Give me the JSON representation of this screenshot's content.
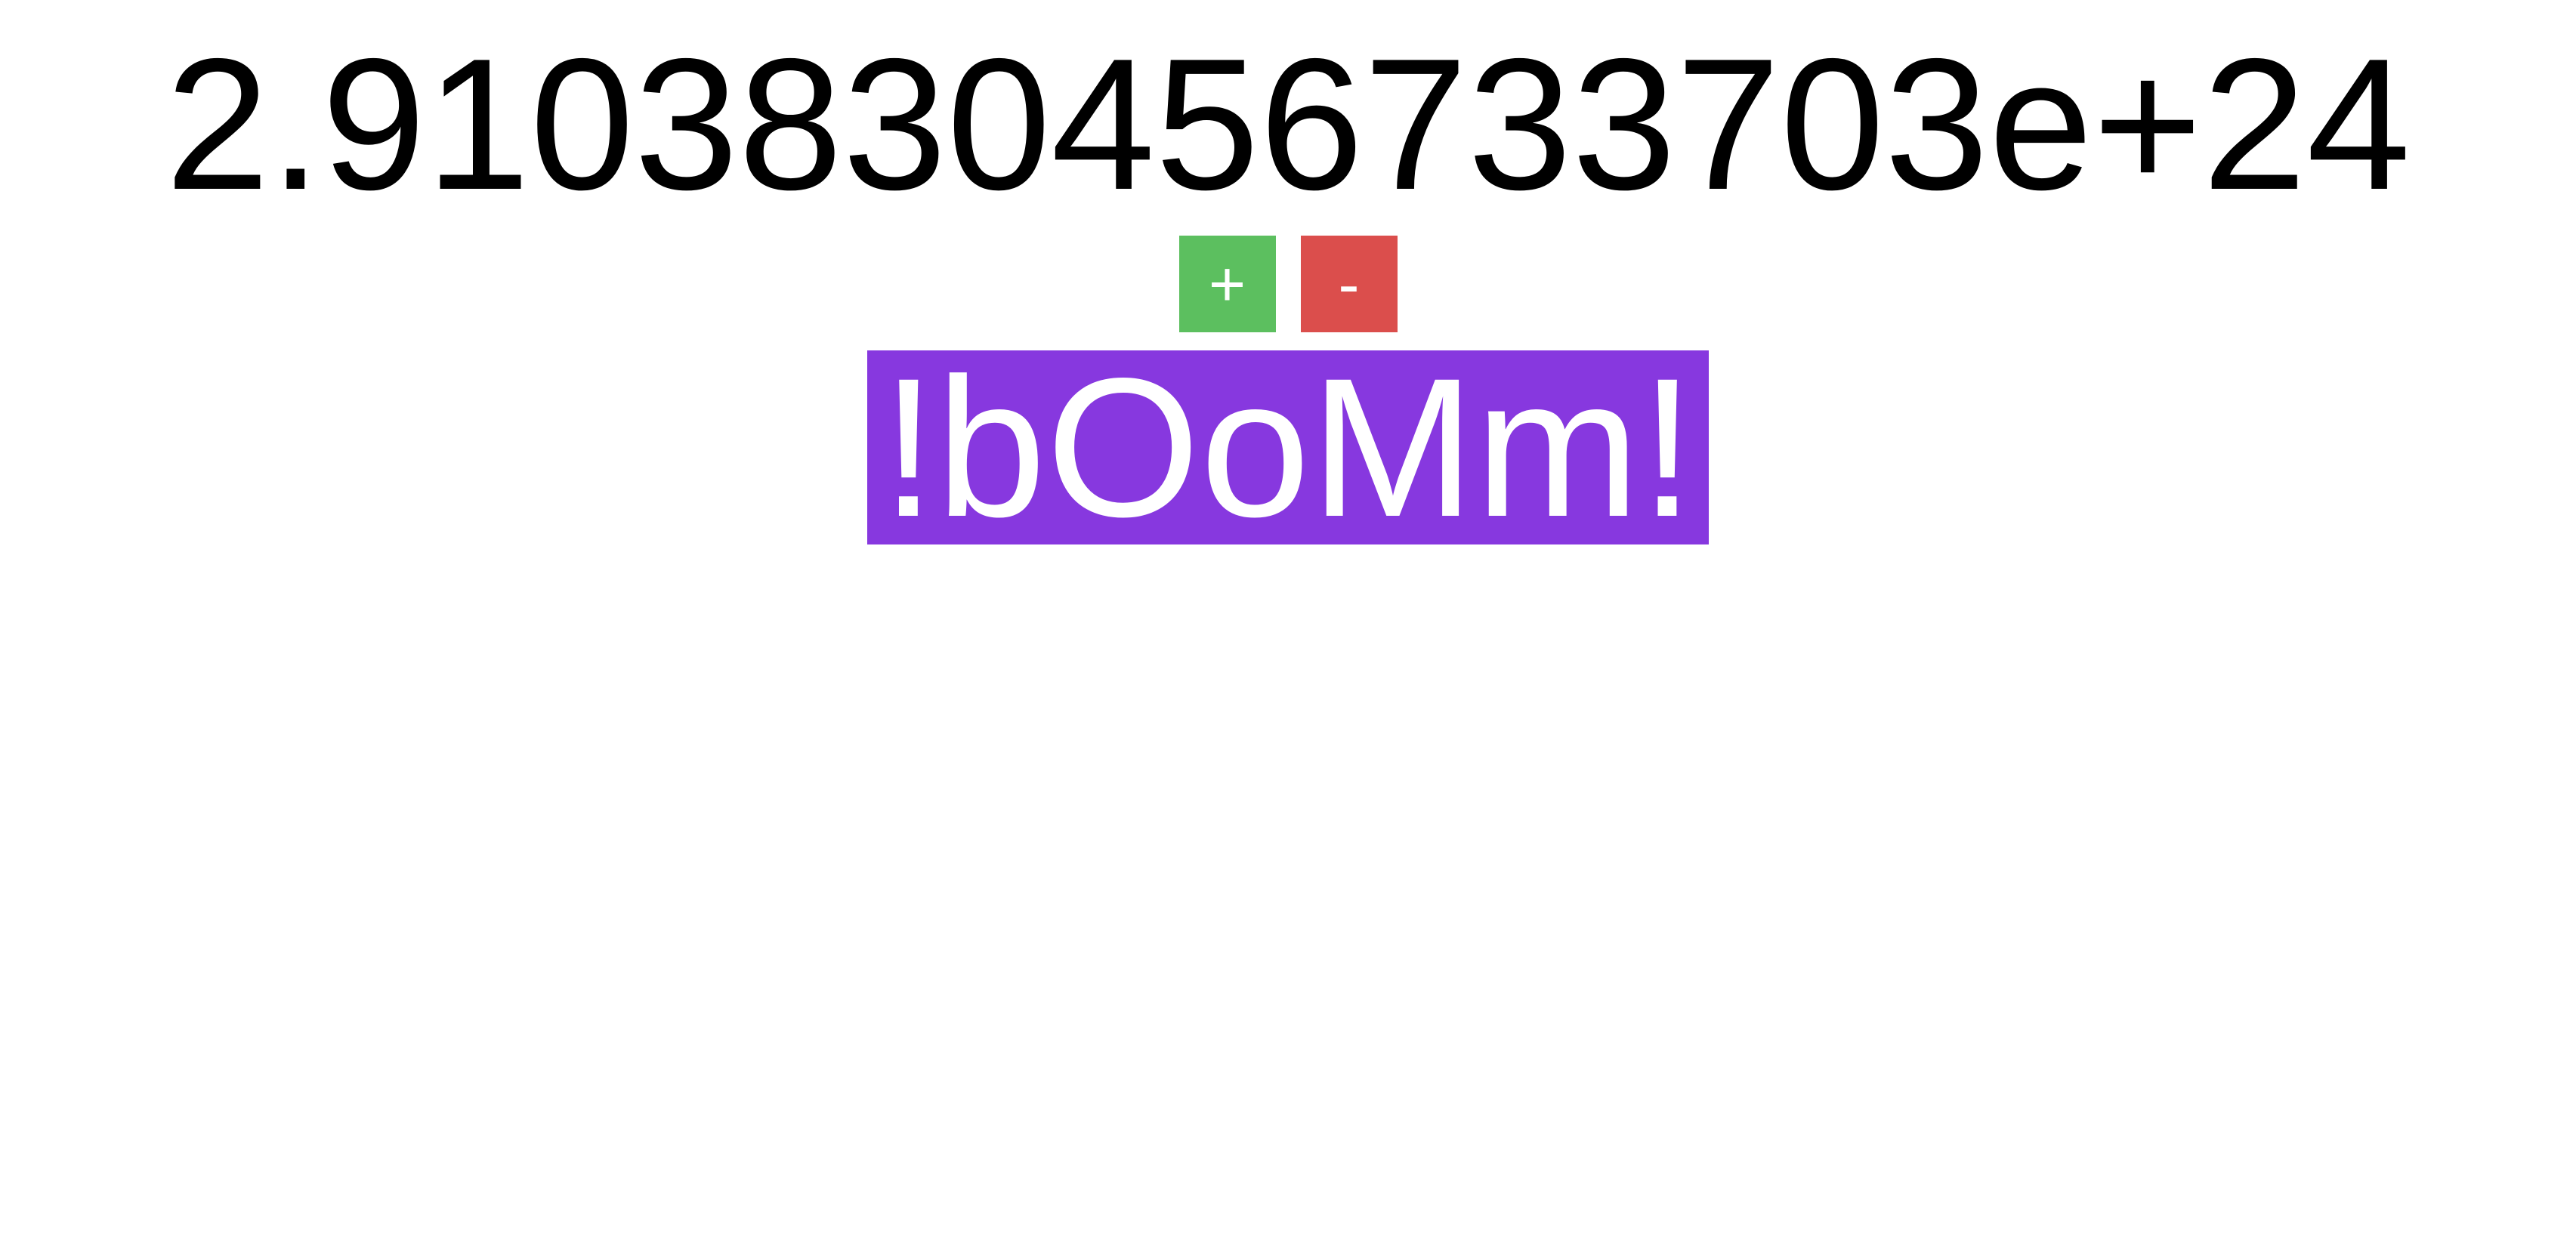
{
  "counter": {
    "value": "2.9103830456733703e+24"
  },
  "controls": {
    "increment_label": "+",
    "decrement_label": "-"
  },
  "banner": {
    "text": "!bOoMm!"
  },
  "colors": {
    "increment_bg": "#5cbf5f",
    "decrement_bg": "#db4e4c",
    "banner_bg": "#8738df",
    "text": "#000000",
    "on_color_text": "#ffffff"
  }
}
